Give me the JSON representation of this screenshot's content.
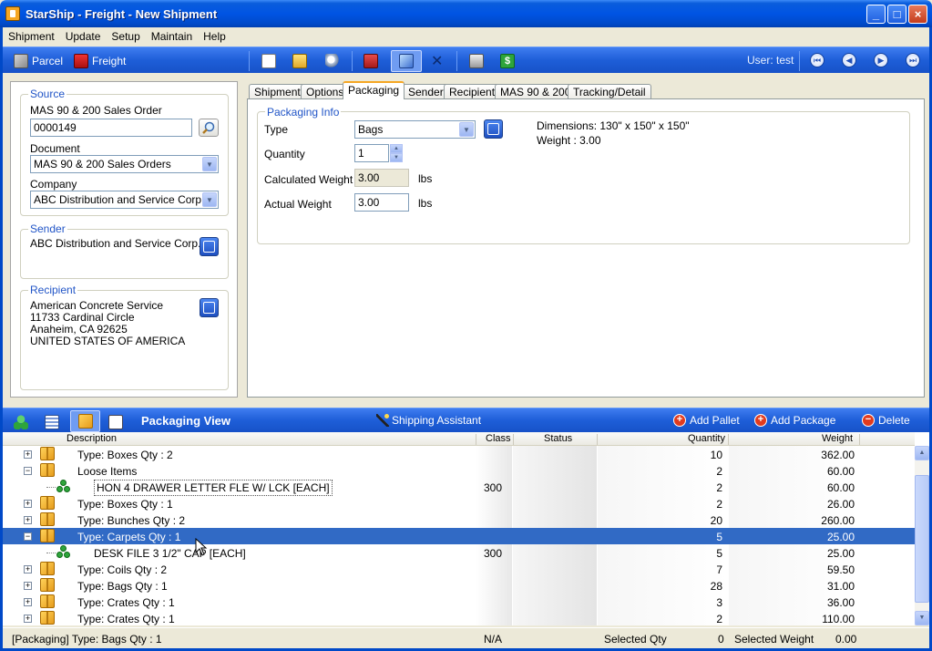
{
  "window": {
    "title": "StarShip - Freight - New Shipment"
  },
  "menu": [
    "Shipment",
    "Update",
    "Setup",
    "Maintain",
    "Help"
  ],
  "toolbar": {
    "parcel_label": "Parcel",
    "freight_label": "Freight",
    "user_label": "User: test"
  },
  "source": {
    "group_title": "Source",
    "order_label": "MAS 90 & 200 Sales Order",
    "order_value": "0000149",
    "document_label": "Document",
    "document_value": "MAS 90 & 200 Sales Orders",
    "company_label": "Company",
    "company_value": "ABC Distribution and Service Corp."
  },
  "sender": {
    "group_title": "Sender",
    "name": "ABC Distribution and Service Corp."
  },
  "recipient": {
    "group_title": "Recipient",
    "line1": "American Concrete Service",
    "line2": "11733 Cardinal Circle",
    "line3": "Anaheim, CA 92625",
    "line4": "UNITED STATES OF AMERICA"
  },
  "tabs": [
    {
      "label": "Shipment"
    },
    {
      "label": "Options"
    },
    {
      "label": "Packaging"
    },
    {
      "label": "Sender"
    },
    {
      "label": "Recipient"
    },
    {
      "label": "MAS 90 & 200"
    },
    {
      "label": "Tracking/Detail"
    }
  ],
  "packaging_info": {
    "group_title": "Packaging Info",
    "type_label": "Type",
    "type_value": "Bags",
    "quantity_label": "Quantity",
    "quantity_value": "1",
    "calc_weight_label": "Calculated Weight",
    "calc_weight_value": "3.00",
    "actual_weight_label": "Actual Weight",
    "actual_weight_value": "3.00",
    "unit": "lbs",
    "dimensions": "Dimensions: 130\" x 150\" x 150\"",
    "weight": "Weight : 3.00"
  },
  "packaging_view": {
    "title": "Packaging View",
    "shipping_assistant": "Shipping Assistant",
    "add_pallet": "Add Pallet",
    "add_package": "Add Package",
    "delete": "Delete"
  },
  "grid": {
    "columns": [
      "Description",
      "Class",
      "Status",
      "Quantity",
      "Weight"
    ],
    "rows": [
      {
        "kind": "package",
        "expander": "+",
        "desc": "Type:  Boxes  Qty : 2",
        "class": "",
        "qty": "10",
        "weight": "362.00"
      },
      {
        "kind": "package",
        "expander": "−",
        "desc": "Loose Items",
        "class": "",
        "qty": "2",
        "weight": "60.00"
      },
      {
        "kind": "item",
        "expander": "",
        "desc": "HON 4 DRAWER LETTER FLE W/ LCK [EACH]",
        "class": "300",
        "qty": "2",
        "weight": "60.00"
      },
      {
        "kind": "package",
        "expander": "+",
        "desc": "Type:  Boxes  Qty : 1",
        "class": "",
        "qty": "2",
        "weight": "26.00"
      },
      {
        "kind": "package",
        "expander": "+",
        "desc": "Type:  Bunches  Qty : 2",
        "class": "",
        "qty": "20",
        "weight": "260.00"
      },
      {
        "kind": "package",
        "expander": "−",
        "desc": "Type:  Carpets  Qty : 1",
        "class": "",
        "qty": "5",
        "weight": "25.00",
        "selected": true
      },
      {
        "kind": "item",
        "expander": "",
        "desc": "DESK FILE 3 1/2\" CAP     [EACH]",
        "class": "300",
        "qty": "5",
        "weight": "25.00"
      },
      {
        "kind": "package",
        "expander": "+",
        "desc": "Type:  Coils  Qty : 2",
        "class": "",
        "qty": "7",
        "weight": "59.50"
      },
      {
        "kind": "package",
        "expander": "+",
        "desc": "Type:  Bags  Qty : 1",
        "class": "",
        "qty": "28",
        "weight": "31.00"
      },
      {
        "kind": "package",
        "expander": "+",
        "desc": "Type:  Crates  Qty : 1",
        "class": "",
        "qty": "3",
        "weight": "36.00"
      },
      {
        "kind": "package",
        "expander": "+",
        "desc": "Type:  Crates  Qty : 1",
        "class": "",
        "qty": "2",
        "weight": "110.00"
      }
    ]
  },
  "status": {
    "current": "[Packaging] Type:  Bags  Qty : 1",
    "class": "N/A",
    "selected_qty_label": "Selected Qty",
    "selected_qty_value": "0",
    "selected_weight_label": "Selected Weight",
    "selected_weight_value": "0.00"
  }
}
